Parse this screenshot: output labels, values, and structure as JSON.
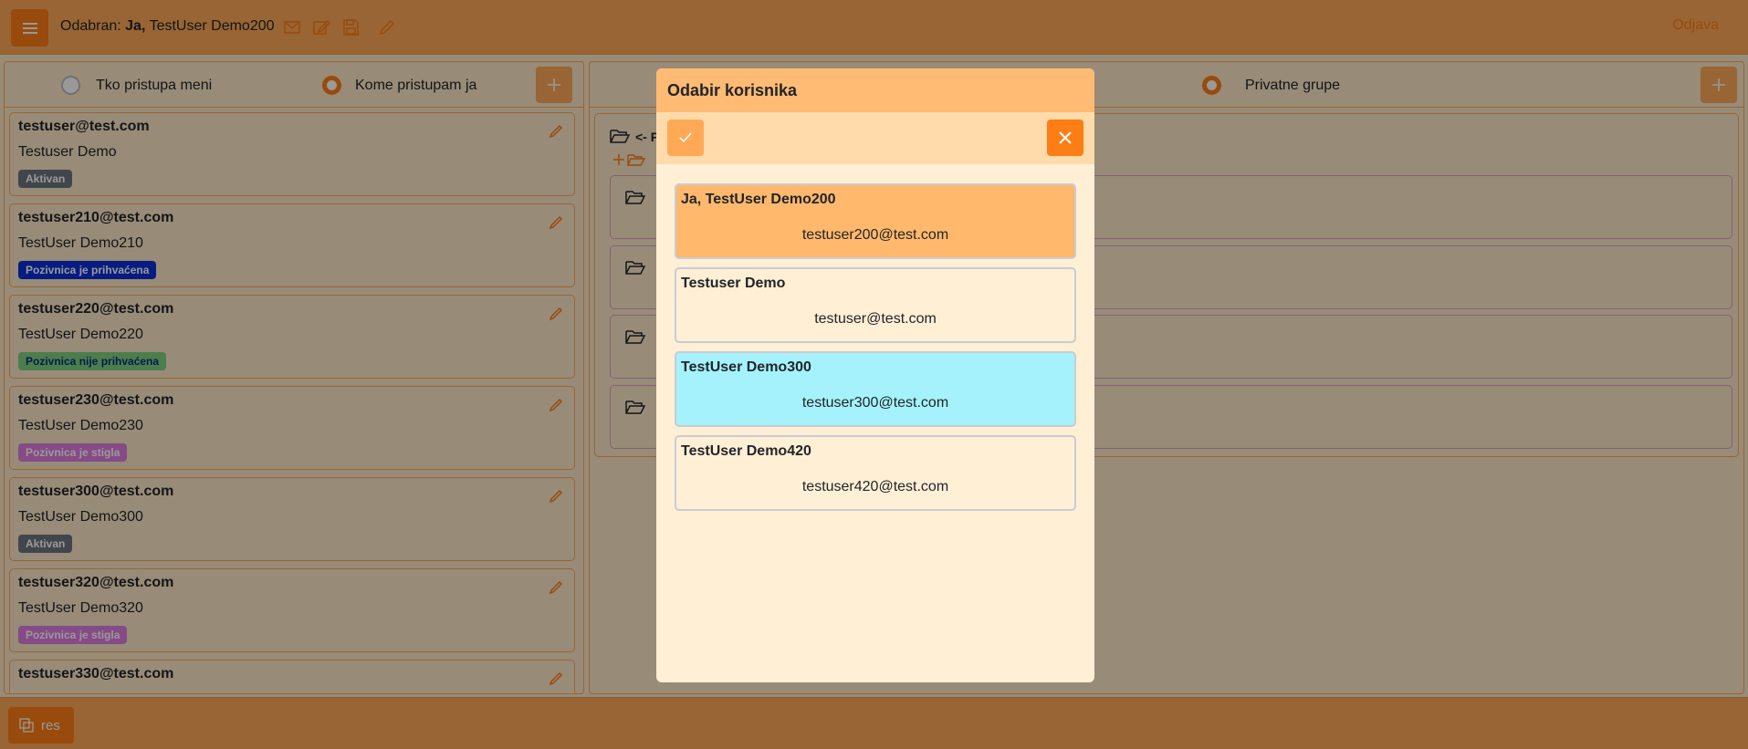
{
  "topbar": {
    "selected_prefix": "Odabran: ",
    "selected_bold": "Ja,",
    "selected_name": " TestUser Demo200",
    "logout": "Odjava"
  },
  "left_panel": {
    "radio_who_accesses_me": "Tko pristupa meni",
    "radio_whom_i_access": "Kome pristupam ja",
    "selected_radio": "Kome pristupam ja",
    "users": [
      {
        "email": "testuser@test.com",
        "name": "Testuser Demo",
        "status": "Aktivan",
        "status_color": "#6c757d"
      },
      {
        "email": "testuser210@test.com",
        "name": "TestUser Demo210",
        "status": "Pozivnica je prihvaćena",
        "status_color": "#0d2fd8"
      },
      {
        "email": "testuser220@test.com",
        "name": "TestUser Demo220",
        "status": "Pozivnica nije prihvaćena",
        "status_color": "#7ed27e"
      },
      {
        "email": "testuser230@test.com",
        "name": "TestUser Demo230",
        "status": "Pozivnica je stigla",
        "status_color": "#e07de0"
      },
      {
        "email": "testuser300@test.com",
        "name": "TestUser Demo300",
        "status": "Aktivan",
        "status_color": "#6c757d"
      },
      {
        "email": "testuser320@test.com",
        "name": "TestUser Demo320",
        "status": "Pozivnica je stigla",
        "status_color": "#e07de0"
      },
      {
        "email": "testuser330@test.com",
        "name": "",
        "status": "",
        "status_color": ""
      }
    ]
  },
  "right_panel": {
    "radio_private_groups": "Privatne grupe",
    "tree_back": "<- P"
  },
  "bottombar": {
    "res_label": "res"
  },
  "modal": {
    "title": "Odabir korisnika",
    "users": [
      {
        "name": "Ja, TestUser Demo200",
        "email": "testuser200@test.com",
        "state": "selected"
      },
      {
        "name": "Testuser Demo",
        "email": "testuser@test.com",
        "state": "normal"
      },
      {
        "name": "TestUser Demo300",
        "email": "testuser300@test.com",
        "state": "hover"
      },
      {
        "name": "TestUser Demo420",
        "email": "testuser420@test.com",
        "state": "normal"
      }
    ]
  },
  "colors": {
    "accent": "#fd7e14",
    "accent_light": "#ffa957",
    "background": "#fee8c8"
  },
  "icons": [
    "menu-icon",
    "envelope-icon",
    "edit-icon",
    "save-icon",
    "pencil-icon",
    "plus-icon",
    "folder-open-icon",
    "check-icon",
    "close-icon",
    "copy-icon"
  ]
}
